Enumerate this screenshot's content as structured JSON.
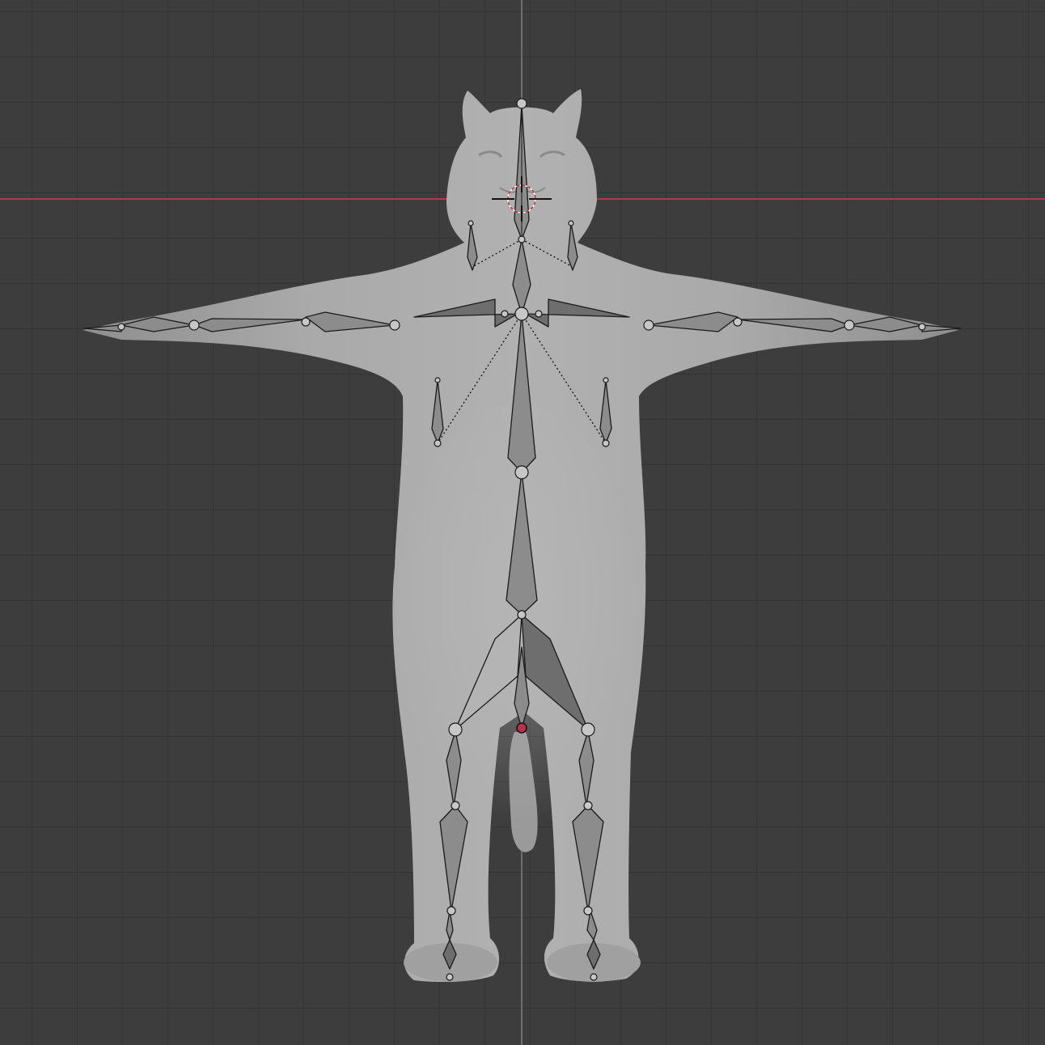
{
  "viewport": {
    "mode": "front-orthographic",
    "object": "cat-mesh-with-armature",
    "colors": {
      "background": "#3d3d3d",
      "grid": "#333333",
      "x_axis": "#b03a4c",
      "z_axis": "#6d6d6d",
      "mesh": "#a6a6a6",
      "bone": "#8c8c8c",
      "bone_outline": "#1a1a1a",
      "active_origin": "#c0304a",
      "cursor": "#c0304a"
    },
    "icons": [
      "3d-cursor-icon",
      "origin-point-icon"
    ]
  }
}
